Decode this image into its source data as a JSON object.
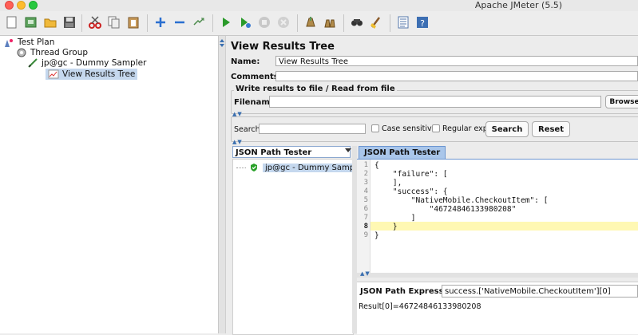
{
  "window": {
    "title": "Apache JMeter (5.5)"
  },
  "toolbar": {
    "icons": [
      "new-icon",
      "templates-icon",
      "open-icon",
      "save-icon",
      "cut-icon",
      "copy-icon",
      "paste-icon",
      "expand-icon",
      "collapse-icon",
      "toggle-icon",
      "start-icon",
      "start-no-pause-icon",
      "stop-icon",
      "shutdown-icon",
      "clear-icon",
      "clear-all-icon",
      "search-icon",
      "reset-search-icon",
      "function-helper-icon",
      "help-icon"
    ]
  },
  "tree": {
    "items": [
      {
        "label": "Test Plan",
        "icon": "test-plan-icon"
      },
      {
        "label": "Thread Group",
        "icon": "thread-group-icon"
      },
      {
        "label": "jp@gc - Dummy Sampler",
        "icon": "sampler-icon"
      },
      {
        "label": "View Results Tree",
        "icon": "listener-icon"
      }
    ]
  },
  "panel": {
    "title": "View Results Tree",
    "name_label": "Name:",
    "name_value": "View Results Tree",
    "comments_label": "Comments:",
    "comments_value": "",
    "file_group_title": "Write results to file / Read from file",
    "filename_label": "Filename",
    "filename_value": "",
    "browse_label": "Browse"
  },
  "search": {
    "label": "Search:",
    "value": "",
    "case_sensitive_label": "Case sensitive",
    "regex_label": "Regular exp.",
    "search_button": "Search",
    "reset_button": "Reset"
  },
  "results": {
    "renderer_selected": "JSON Path Tester",
    "sample_label": "jp@gc - Dummy Sampler",
    "sample_status_color": "#2aa12a",
    "tab_label": "JSON Path Tester",
    "code_lines": [
      "{",
      "    \"failure\": [",
      "    ],",
      "    \"success\": {",
      "        \"NativeMobile.CheckoutItem\": [",
      "            \"46724846133980208\"",
      "        ]",
      "    }",
      "}"
    ],
    "line_numbers": [
      "1",
      "2",
      "3",
      "4",
      "5",
      "6",
      "7",
      "8",
      "9"
    ],
    "current_line": 8,
    "expr_label": "JSON Path Expression",
    "expr_value": "success.['NativeMobile.CheckoutItem'][0]",
    "result_text": "Result[0]=46724846133980208"
  },
  "colors": {
    "selection": "#c5d8ee",
    "tab_active": "#a9c6ea",
    "current_line": "#fff8b3"
  }
}
